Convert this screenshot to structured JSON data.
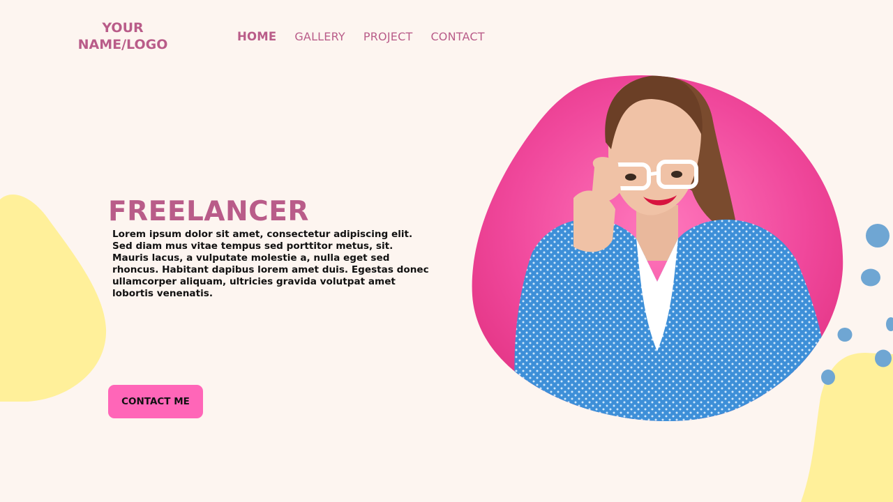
{
  "logo": {
    "line1": "YOUR",
    "line2": "NAME/LOGO"
  },
  "nav": {
    "items": [
      {
        "label": "HOME",
        "active": true
      },
      {
        "label": "GALLERY",
        "active": false
      },
      {
        "label": "PROJECT",
        "active": false
      },
      {
        "label": "CONTACT",
        "active": false
      }
    ]
  },
  "hero": {
    "title": "FREELANCER",
    "body": "Lorem ipsum dolor sit amet, consectetur adipiscing elit. Sed diam mus vitae tempus sed porttitor metus, sit. Mauris lacus, a vulputate molestie a, nulla eget sed rhoncus. Habitant dapibus lorem amet duis. Egestas donec ullamcorper aliquam, ultricies gravida volutpat amet lobortis venenatis.",
    "cta_label": "CONTACT ME"
  },
  "colors": {
    "background": "#fdf5f0",
    "accent_text": "#b95c89",
    "button": "#ff66b8",
    "yellow_blob": "#fff09a",
    "blue_dots": "#6fa6d3",
    "photo_backdrop": "#f0489c"
  }
}
